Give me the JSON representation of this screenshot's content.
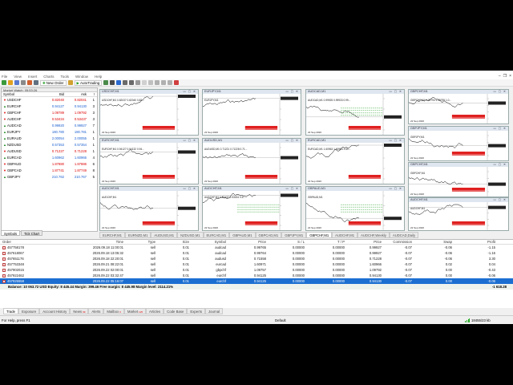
{
  "menu": [
    "File",
    "View",
    "Insert",
    "Charts",
    "Tools",
    "Window",
    "Help"
  ],
  "toolbar": {
    "new_order": "New Order",
    "autotrading": "AutoTrading"
  },
  "market_watch": {
    "title": "Market Watch: 05:53:26",
    "columns": [
      "Symbol",
      "Bid",
      "Ask",
      "!"
    ],
    "rows": [
      {
        "symbol": "USDCHF",
        "bid": "0.82040",
        "ask": "0.82041",
        "spread": "1",
        "dir": "dn"
      },
      {
        "symbol": "EURCHF",
        "bid": "0.94127",
        "ask": "0.94130",
        "spread": "3",
        "dir": "up"
      },
      {
        "symbol": "GBPCHF",
        "bid": "1.09789",
        "ask": "1.09792",
        "spread": "3",
        "dir": "dn"
      },
      {
        "symbol": "AUDCHF",
        "bid": "0.53434",
        "ask": "0.53437",
        "spread": "3",
        "dir": "dn"
      },
      {
        "symbol": "AUDCAD",
        "bid": "0.99920",
        "ask": "0.99927",
        "spread": "7",
        "dir": "up"
      },
      {
        "symbol": "EURJPY",
        "bid": "180.780",
        "ask": "180.781",
        "spread": "1",
        "dir": "up"
      },
      {
        "symbol": "EURAUD",
        "bid": "2.00054",
        "ask": "2.00055",
        "spread": "1",
        "dir": "up"
      },
      {
        "symbol": "NZDUSD",
        "bid": "0.57353",
        "ask": "0.57354",
        "spread": "1",
        "dir": "up"
      },
      {
        "symbol": "AUDUSD",
        "bid": "0.71227",
        "ask": "0.71228",
        "spread": "1",
        "dir": "dn"
      },
      {
        "symbol": "EURCAD",
        "bid": "1.60962",
        "ask": "1.60966",
        "spread": "4",
        "dir": "up"
      },
      {
        "symbol": "GBPAUD",
        "bid": "1.87880",
        "ask": "1.87886",
        "spread": "6",
        "dir": "dn"
      },
      {
        "symbol": "GBPCAD",
        "bid": "1.87741",
        "ask": "1.87749",
        "spread": "8",
        "dir": "dn"
      },
      {
        "symbol": "GBPJPY",
        "bid": "210.762",
        "ask": "210.767",
        "spread": "5",
        "dir": "up"
      }
    ],
    "tabs": [
      "Symbols",
      "Tick Chart"
    ]
  },
  "charts": [
    {
      "title": "USDCHF,M1",
      "label": "USDCHF,M1  0.82037 0.82040 0.82...",
      "date": "22 Sep 2026"
    },
    {
      "title": "EURJPY,M1",
      "label": "EURJPY,M1",
      "date": "22 Sep 2026"
    },
    {
      "title": "AUDCAD,M1",
      "label": "AUDCAD,M1  0.99925 0.99933 0.99...",
      "date": "22 Sep 2026"
    },
    {
      "title": "GBPCHF,M1",
      "label": "GBPCHF,M1  1.09794 1.09795 1.0...",
      "date": "22 Sep 2026"
    },
    {
      "title": "EURCHF,M1",
      "label": "EURCHF,M1  0.94127 0.94132 0.94...",
      "date": "22 Sep 2026"
    },
    {
      "title": "AUDUSD,M1",
      "label": "AUDUSD,M1  0.71221 0.71228 0.71...",
      "date": "22 Sep 2026"
    },
    {
      "title": "EURCAD,M1",
      "label": "EURCAD,M1  1.60963 1.60964 1.60...",
      "date": "22 Sep 2026"
    },
    {
      "title": "GBPJPY,M1",
      "label": "GBPJPY,M1",
      "date": "22 Sep 2026"
    },
    {
      "title": "AUDCHF,M1",
      "label": "AUDCHF,M1",
      "date": "22 Sep 2026"
    },
    {
      "title": "AUDCHF,M1",
      "label": "AUDCHF,M1  0.53437 0.53434 0.5...",
      "date": "22 Sep 2026"
    },
    {
      "title": "GBPAUD,M1",
      "label": "GBPAUD,M1",
      "date": "22 Sep 2026"
    },
    {
      "title": "GBPCHF,M1",
      "label": "GBPCHF,M1",
      "date": "22 Sep 2026"
    },
    {
      "title": "AUDCHF,M1",
      "label": "AUDCHF,M1",
      "date": "22 Sep 2026"
    }
  ],
  "chart_tabs": [
    "EURCHF,M1",
    "EURNZD,M1",
    "AUDUSD,M1",
    "NZDUSD,M1",
    "EURCAD,M1",
    "GBPAUD,M1",
    "GBPCAD,M1",
    "GBPJPY,M1",
    "GBPCHF,M1",
    "AUDCHF,M1",
    "AUDCHF,Weekly",
    "AUDCAD,Daily"
  ],
  "chart_tabs_active": 8,
  "terminal": {
    "columns": [
      "Order",
      "Time",
      "Type",
      "Size",
      "Symbol",
      "Price",
      "S / L",
      "T / P",
      "Price",
      "Commission",
      "Swap",
      "Profit"
    ],
    "rows": [
      [
        "457758178",
        "2026.09.18 11:00:01",
        "sell",
        "0.01",
        "audcad",
        "0.99765",
        "0.00000",
        "0.00000",
        "0.99927",
        "-0.07",
        "-0.06",
        "-1.15"
      ],
      [
        "457618067",
        "2026.09.18 13:05:32",
        "sell",
        "0.01",
        "audcad",
        "0.99764",
        "0.00000",
        "0.00000",
        "0.99927",
        "-0.07",
        "-0.06",
        "-1.16"
      ],
      [
        "457651176",
        "2026.09.18 22:20:01",
        "sell",
        "0.01",
        "audusd",
        "0.71558",
        "0.00000",
        "0.00000",
        "0.71228",
        "-0.07",
        "-0.06",
        "3.30"
      ],
      [
        "457753348",
        "2026.09.21 08:22:01",
        "sell",
        "0.01",
        "eurcad",
        "1.60971",
        "0.00000",
        "0.00000",
        "1.60966",
        "-0.07",
        "0.02",
        "0.04"
      ],
      [
        "457902015",
        "2026.09.22 02:00:01",
        "sell",
        "0.01",
        "gbpchf",
        "1.09757",
        "0.00000",
        "0.00000",
        "1.09792",
        "-0.07",
        "0.00",
        "-0.43"
      ],
      [
        "457922462",
        "2026.09.22 03:32:47",
        "sell",
        "0.01",
        "eurchf",
        "0.94125",
        "0.00000",
        "0.00000",
        "0.94130",
        "-0.07",
        "0.00",
        "-0.06"
      ],
      [
        "457925558",
        "2026.09.22 05:16:07",
        "sell",
        "0.01",
        "eurchf",
        "0.94125",
        "0.00000",
        "0.00000",
        "0.94130",
        "-0.07",
        "0.00",
        "-0.06"
      ]
    ],
    "selected_row": 6,
    "balance": "Balance: 10 063.72 USD  Equity: 8 445.44  Margin: 399.46  Free margin: 8 445.98  Margin level: 2114.21%",
    "balance_profit": "-1 618.28"
  },
  "terminal_tabs": [
    {
      "label": "Trade",
      "badge": ""
    },
    {
      "label": "Exposure",
      "badge": ""
    },
    {
      "label": "Account History",
      "badge": ""
    },
    {
      "label": "News",
      "badge": "99"
    },
    {
      "label": "Alerts",
      "badge": ""
    },
    {
      "label": "Mailbox",
      "badge": "6"
    },
    {
      "label": "Market",
      "badge": "125"
    },
    {
      "label": "Articles",
      "badge": ""
    },
    {
      "label": "Code Base",
      "badge": ""
    },
    {
      "label": "Experts",
      "badge": ""
    },
    {
      "label": "Journal",
      "badge": ""
    }
  ],
  "status": {
    "help": "For Help, press F1",
    "profile": "Default",
    "traffic": "18455/23 kb"
  },
  "colors": {
    "up_candle": "#000000",
    "price_line_red": "#e02020",
    "price_line_green": "#1a9a1a",
    "selection": "#1c6fd1"
  }
}
